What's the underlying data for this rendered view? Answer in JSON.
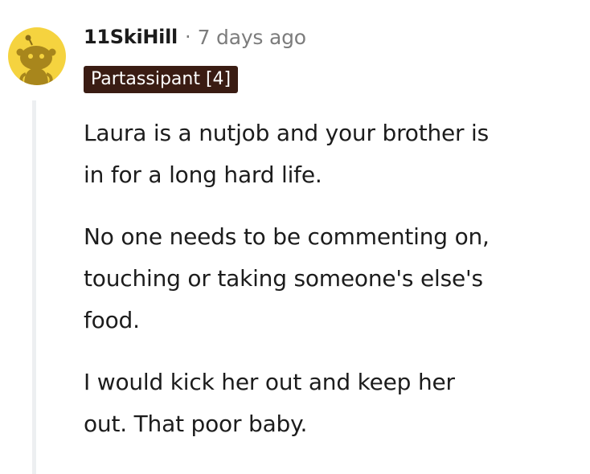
{
  "comment": {
    "avatar_icon": "reddit-snoo-avatar-icon",
    "avatar_color": "#f5d33f",
    "username": "11SkiHill",
    "separator": "·",
    "timestamp": "7 days ago",
    "flair": {
      "label": "Partassipant [4]",
      "background": "#3a1c13",
      "text_color": "#ffffff"
    },
    "paragraphs": [
      {
        "lines": [
          "Laura is a nutjob and your brother is",
          "in for a long hard life."
        ]
      },
      {
        "lines": [
          "No one needs to be commenting on,",
          "touching or taking someone's else's",
          "food."
        ]
      },
      {
        "lines": [
          "I would kick her out and keep her",
          "out. That poor baby."
        ]
      }
    ]
  }
}
